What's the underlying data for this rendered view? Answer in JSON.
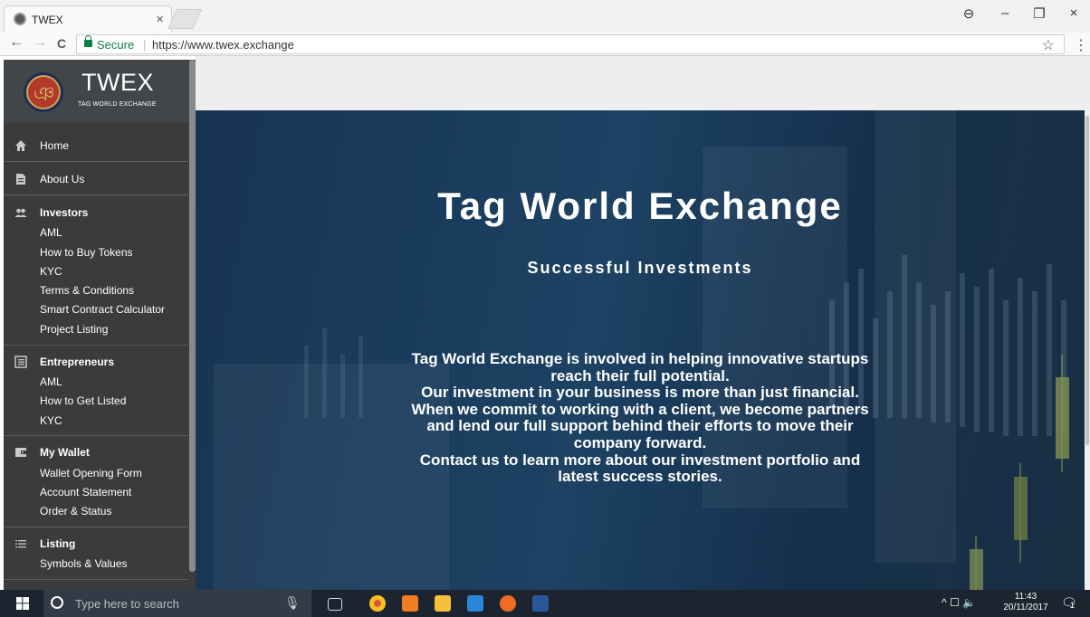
{
  "browser": {
    "tab_title": "TWEX",
    "tab_close": "×",
    "secure_label": "Secure",
    "separator": "|",
    "url": "https://www.twex.exchange",
    "controls": {
      "account": "⊖",
      "minimize": "–",
      "restore": "❐",
      "close": "×"
    },
    "nav": {
      "back": "←",
      "forward": "→",
      "reload": "C"
    },
    "star": "☆",
    "menu": "⋮"
  },
  "sidebar": {
    "logo_name": "TWEX",
    "logo_subtitle": "TAG WORLD EXCHANGE",
    "logo_swirl": "ঞ",
    "home": "Home",
    "about": "About Us",
    "investors": {
      "label": "Investors",
      "items": [
        "AML",
        "How to Buy Tokens",
        "KYC",
        "Terms & Conditions",
        "Smart Contract Calculator",
        "Project Listing"
      ]
    },
    "entrepreneurs": {
      "label": "Entrepreneurs",
      "items": [
        "AML",
        "How to Get Listed",
        "KYC"
      ]
    },
    "wallet": {
      "label": "My Wallet",
      "items": [
        "Wallet Opening Form",
        "Account Statement",
        "Order & Status"
      ]
    },
    "listing": {
      "label": "Listing",
      "items": [
        "Symbols & Values"
      ]
    }
  },
  "hero": {
    "title": "Tag World Exchange",
    "subtitle": "Successful Investments",
    "body_lines": [
      "Tag World Exchange is involved in helping innovative startups",
      "reach their full potential.",
      "Our investment in your business is more than just financial.",
      "When we commit to working with a client, we become partners",
      "and lend our full support behind their efforts to move their",
      "company forward.",
      "Contact us to learn more about our investment portfolio and",
      "latest success stories."
    ]
  },
  "taskbar": {
    "search_placeholder": "Type here to search",
    "tray": "^ ☐ 🔈",
    "time": "11:43",
    "date": "20/11/2017",
    "notification_count": "1"
  },
  "colors": {
    "sidebar_bg": "#3b3b3b",
    "hero_bg": "#173452",
    "secure_green": "#0b8043",
    "taskbar_bg": "#1c2430"
  }
}
